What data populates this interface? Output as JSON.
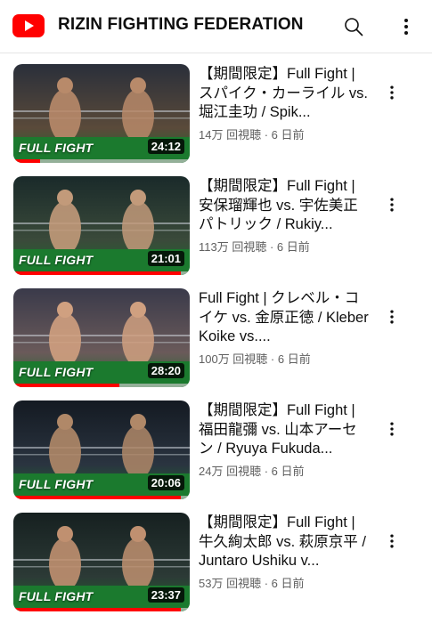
{
  "header": {
    "channel_title": "RIZIN FIGHTING FEDERATION",
    "logo_icon": "youtube-logo-icon",
    "search_icon": "search-icon",
    "menu_icon": "more-vertical-icon",
    "brand_color": "#ff0000"
  },
  "videos": [
    {
      "title": "【期間限定】Full Fight | スパイク・カーライル vs. 堀江圭功 / Spik...",
      "views": "14万 回視聴",
      "age": "6 日前",
      "duration": "24:12",
      "tag": "FULL FIGHT",
      "watched_fraction": 0.15
    },
    {
      "title": "【期間限定】Full Fight | 安保瑠輝也 vs. 宇佐美正パトリック / Rukiy...",
      "views": "113万 回視聴",
      "age": "6 日前",
      "duration": "21:01",
      "tag": "FULL FIGHT",
      "watched_fraction": 0.95
    },
    {
      "title": "Full Fight | クレベル・コイケ vs. 金原正徳 / Kleber Koike vs....",
      "views": "100万 回視聴",
      "age": "6 日前",
      "duration": "28:20",
      "tag": "FULL FIGHT",
      "watched_fraction": 0.6
    },
    {
      "title": "【期間限定】Full Fight | 福田龍彌 vs. 山本アーセン / Ryuya Fukuda...",
      "views": "24万 回視聴",
      "age": "6 日前",
      "duration": "20:06",
      "tag": "FULL FIGHT",
      "watched_fraction": 0.95
    },
    {
      "title": "【期間限定】Full Fight | 牛久絢太郎 vs. 萩原京平 / Juntaro Ushiku v...",
      "views": "53万 回視聴",
      "age": "6 日前",
      "duration": "23:37",
      "tag": "FULL FIGHT",
      "watched_fraction": 0.95
    }
  ]
}
